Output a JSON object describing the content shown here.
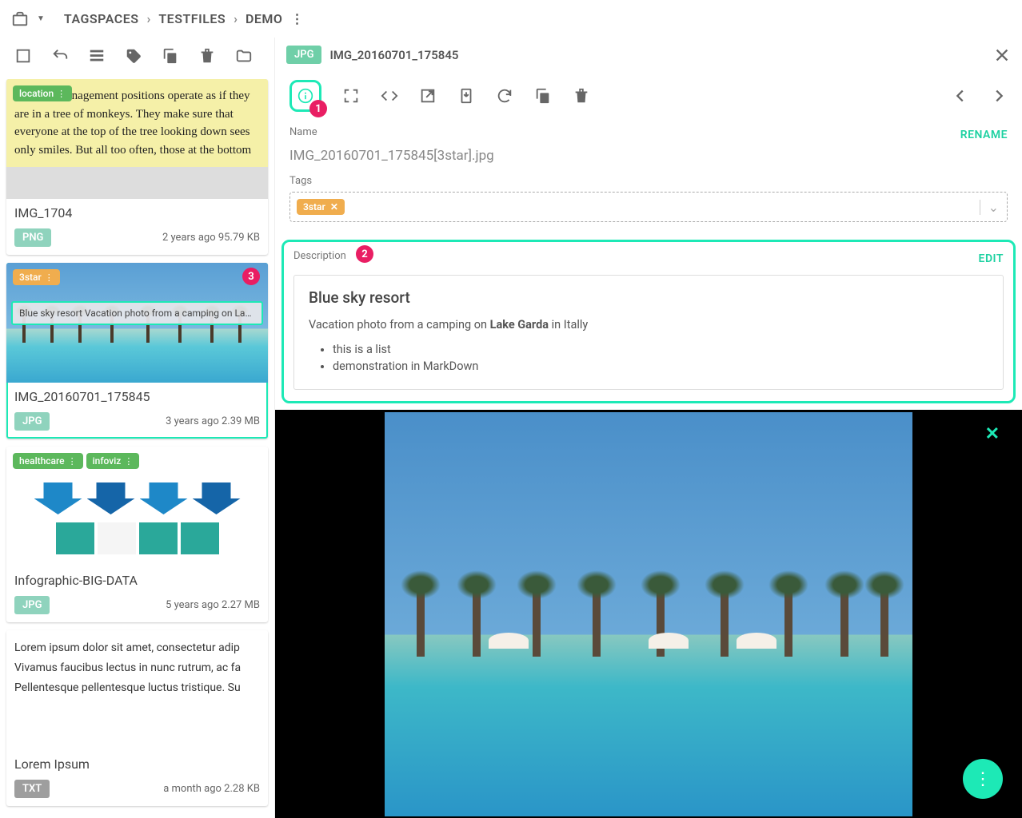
{
  "breadcrumb": {
    "items": [
      "TAGSPACES",
      "TESTFILES",
      "DEMO"
    ]
  },
  "left_toolbar": {
    "icons": [
      "select-all",
      "return",
      "list-view",
      "tag",
      "copy",
      "delete",
      "new-folder"
    ]
  },
  "files": [
    {
      "title": "IMG_1704",
      "ext": "PNG",
      "meta": "2 years ago 95.79 KB",
      "tags": [
        {
          "label": "location",
          "color": "green"
        }
      ],
      "thumb": "highlight-text",
      "thumb_text": "Some in management positions operate as if they are in a tree of monkeys. They make sure that everyone at the top of the tree looking down sees only smiles. But all too often, those at the bottom"
    },
    {
      "title": "IMG_20160701_175845",
      "ext": "JPG",
      "meta": "3 years ago 2.39 MB",
      "tags": [
        {
          "label": "3star",
          "color": "orange"
        }
      ],
      "selected": true,
      "desc_strip": "Blue sky resort Vacation photo from a camping on La…",
      "callout": "3",
      "thumb": "sky"
    },
    {
      "title": "Infographic-BIG-DATA",
      "ext": "JPG",
      "meta": "5 years ago 2.27 MB",
      "tags": [
        {
          "label": "healthcare",
          "color": "green"
        },
        {
          "label": "infoviz",
          "color": "green"
        }
      ],
      "thumb": "infographic"
    },
    {
      "title": "Lorem Ipsum",
      "ext": "TXT",
      "meta": "a month ago 2.28 KB",
      "thumb": "lorem",
      "thumb_text": "Lorem ipsum dolor sit amet, consectetur adip\nVivamus faucibus lectus in nunc rutrum, ac fa\nPellentesque pellentesque luctus tristique. Su"
    }
  ],
  "detail": {
    "ext": "JPG",
    "title": "IMG_20160701_175845",
    "name_label": "Name",
    "rename_label": "RENAME",
    "filename": "IMG_20160701_175845[3star].jpg",
    "tags_label": "Tags",
    "tags": [
      {
        "label": "3star"
      }
    ],
    "description_label": "Description",
    "edit_label": "EDIT",
    "desc_heading": "Blue sky resort",
    "desc_para_pre": "Vacation photo from a camping on ",
    "desc_para_bold": "Lake Garda",
    "desc_para_post": " in Itally",
    "desc_list": [
      "this is a list",
      "demonstration in MarkDown"
    ],
    "callouts": {
      "info": "1",
      "desc": "2"
    }
  }
}
